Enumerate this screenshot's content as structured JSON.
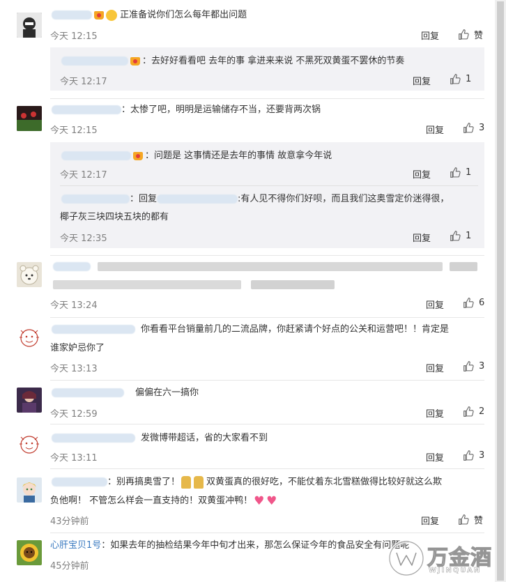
{
  "comments": [
    {
      "text": "正准备说你们怎么每年都出问题",
      "time": "今天 12:15",
      "reply": "回复",
      "like": "赞"
    },
    {
      "sub": true,
      "text": "：去好好看看吧 去年的事 拿进来来说 不黑死双黄蛋不罢休的节奏",
      "time": "今天 12:17",
      "reply": "回复",
      "like": "1"
    },
    {
      "text": "：太惨了吧，明明是运输储存不当，还要背两次锅",
      "time": "今天 12:15",
      "reply": "回复",
      "like": "3"
    },
    {
      "sub": true,
      "text": "：问题是 这事情还是去年的事情 故意拿今年说",
      "time": "今天 12:17",
      "reply": "回复",
      "like": "1"
    },
    {
      "sub": true,
      "text_a": "：回复",
      "text_b": ":有人见不得你们好呗，而且我们这奥雪定价迷得很，",
      "text_c": "椰子灰三块四块五块的都有",
      "time": "今天 12:35",
      "reply": "回复",
      "like": "1"
    },
    {
      "time": "今天 13:24",
      "reply": "回复",
      "like": "6"
    },
    {
      "text_a": "你看看平台销量前几的二流品牌，你赶紧请个好点的公关和运营吧！！肯定是",
      "text_b": "谁家妒忌你了",
      "time": "今天 13:13",
      "reply": "回复",
      "like": "3"
    },
    {
      "text": "偏偏在六一搞你",
      "time": "今天 12:59",
      "reply": "回复",
      "like": "2"
    },
    {
      "text": "发微博带超话，省的大家看不到",
      "time": "今天 13:11",
      "reply": "回复",
      "like": "3"
    },
    {
      "text_a": "：别再搞奥雪了！",
      "text_b": "双黄蛋真的很好吃，不能仗着东北雪糕做得比较好就这么欺",
      "text_c": "负他啊！ 不管怎么样会一直支持的！双黄蛋冲鸭！",
      "time": "43分钟前",
      "reply": "回复",
      "like": "赞"
    },
    {
      "user": "心肝宝贝1号",
      "text": "：如果去年的抽检结果今年中旬才出来，那怎么保证今年的食品安全有问题呢",
      "time": "45分钟前"
    }
  ],
  "watermark": {
    "cn": "万金酒",
    "en": "WJINQUAN"
  }
}
